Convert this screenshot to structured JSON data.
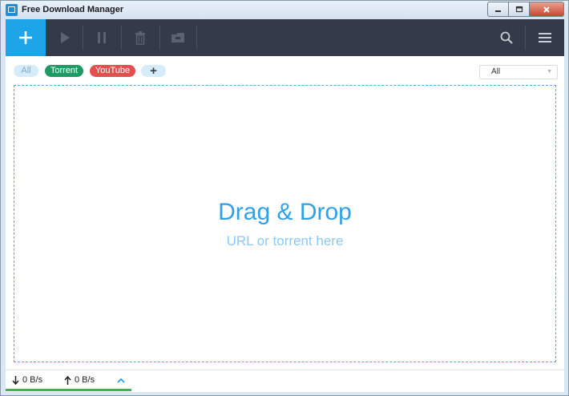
{
  "window": {
    "title": "Free Download Manager",
    "controls": [
      "minimize",
      "maximize",
      "close"
    ]
  },
  "toolbar": {
    "buttons": [
      {
        "name": "add",
        "icon": "plus-icon"
      },
      {
        "name": "start",
        "icon": "play-icon"
      },
      {
        "name": "pause",
        "icon": "pause-icon"
      },
      {
        "name": "delete",
        "icon": "trash-icon"
      },
      {
        "name": "move",
        "icon": "folder-icon"
      },
      {
        "name": "search",
        "icon": "search-icon"
      },
      {
        "name": "menu",
        "icon": "hamburger-menu-icon"
      }
    ],
    "add_label": "+"
  },
  "filters": {
    "tags": [
      {
        "label": "All",
        "color": "#d6ecf8",
        "text_color": "#86a8bf"
      },
      {
        "label": "Torrent",
        "color": "#1e9b63",
        "text_color": "#ffffff"
      },
      {
        "label": "YouTube",
        "color": "#e24f4f",
        "text_color": "#ffffff"
      }
    ],
    "add_tag_label": "+",
    "status_select": {
      "selected": "All"
    }
  },
  "dropzone": {
    "title": "Drag & Drop",
    "subtitle": "URL or torrent here"
  },
  "status": {
    "download_speed": "0 B/s",
    "upload_speed": "0 B/s"
  },
  "colors": {
    "toolbar_bg": "#333a49",
    "accent": "#1ea5e9",
    "dropzone_border": "#45aee5",
    "speed_indicator": "#3fb34f"
  }
}
